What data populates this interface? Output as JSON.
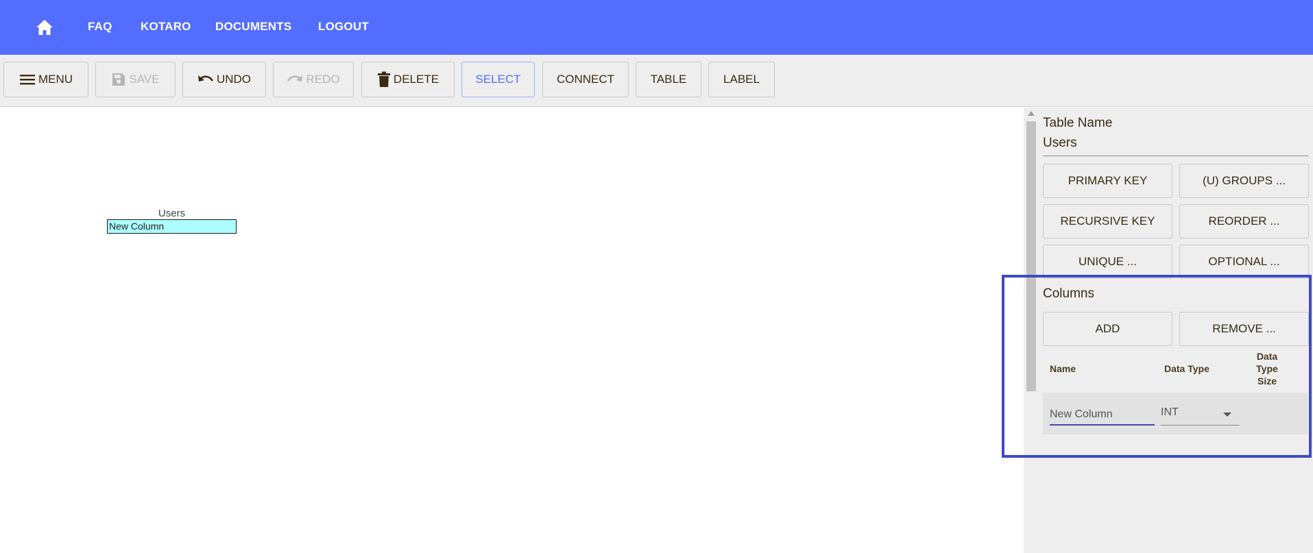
{
  "nav": {
    "home_icon": "home-icon",
    "links": [
      "FAQ",
      "KOTARO",
      "DOCUMENTS",
      "LOGOUT"
    ]
  },
  "toolbar": {
    "menu": "MENU",
    "save": "SAVE",
    "undo": "UNDO",
    "redo": "REDO",
    "delete": "DELETE",
    "select": "SELECT",
    "connect": "CONNECT",
    "table": "TABLE",
    "label": "LABEL"
  },
  "canvas": {
    "table": {
      "name": "Users",
      "columns": [
        "New Column"
      ]
    }
  },
  "panel": {
    "table_name_label": "Table Name",
    "table_name_value": "Users",
    "buttons": {
      "primary_key": "PRIMARY KEY",
      "u_groups": "(U) GROUPS ...",
      "recursive_key": "RECURSIVE KEY",
      "reorder": "REORDER ...",
      "unique": "UNIQUE ...",
      "optional": "OPTIONAL ..."
    },
    "columns_label": "Columns",
    "add": "ADD",
    "remove": "REMOVE ...",
    "headers": {
      "name": "Name",
      "data_type": "Data Type",
      "data_type_size": "Data Type Size"
    },
    "rows": [
      {
        "name": "New Column",
        "data_type": "INT"
      }
    ]
  },
  "colors": {
    "header_bg": "#536dfe",
    "toolbar_bg": "#eeeeee",
    "column_fill": "#adffff",
    "highlight": "#3e4ac4"
  }
}
